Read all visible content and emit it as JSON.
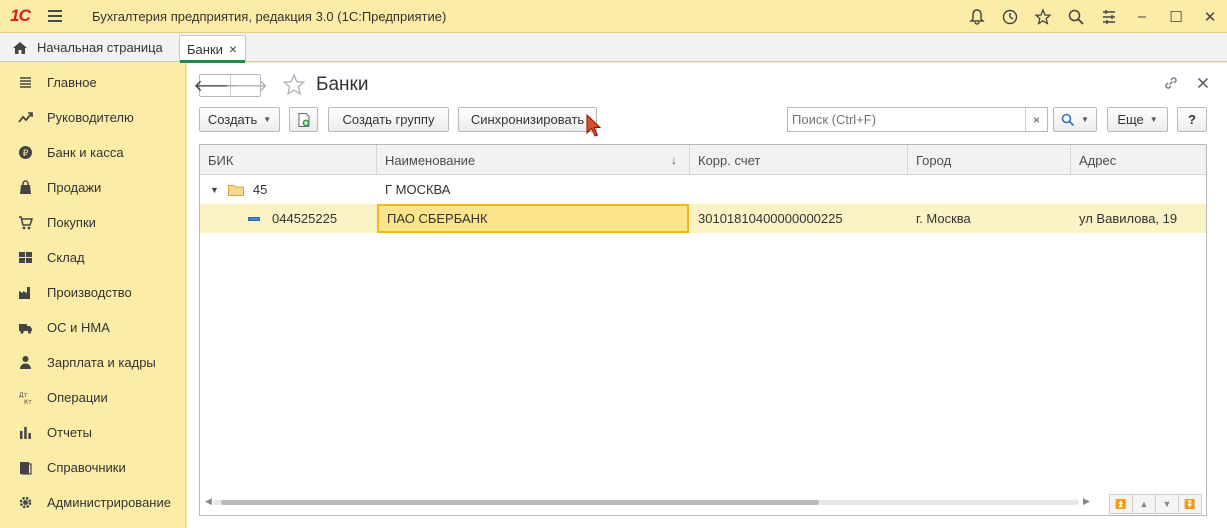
{
  "titlebar": {
    "logo": "1С",
    "app_title": "Бухгалтерия предприятия, редакция 3.0  (1С:Предприятие)",
    "icons": [
      "bell-icon",
      "history-icon",
      "star-icon",
      "search-icon",
      "settings-sliders-icon"
    ],
    "minimize": "‒",
    "maximize": "☐",
    "close": "✕"
  },
  "tabs": {
    "home": "Начальная страница",
    "active": "Банки",
    "active_close": "×"
  },
  "sidebar": {
    "items": [
      {
        "label": "Главное",
        "icon": "menu-lines-icon"
      },
      {
        "label": "Руководителю",
        "icon": "trend-icon"
      },
      {
        "label": "Банк и касса",
        "icon": "coin-icon"
      },
      {
        "label": "Продажи",
        "icon": "bag-icon"
      },
      {
        "label": "Покупки",
        "icon": "cart-icon"
      },
      {
        "label": "Склад",
        "icon": "warehouse-icon"
      },
      {
        "label": "Производство",
        "icon": "factory-icon"
      },
      {
        "label": "ОС и НМА",
        "icon": "truck-icon"
      },
      {
        "label": "Зарплата и кадры",
        "icon": "person-icon"
      },
      {
        "label": "Операции",
        "icon": "dt-kt-icon"
      },
      {
        "label": "Отчеты",
        "icon": "bar-chart-icon"
      },
      {
        "label": "Справочники",
        "icon": "book-icon"
      },
      {
        "label": "Администрирование",
        "icon": "gear-icon"
      }
    ]
  },
  "form": {
    "title": "Банки",
    "back": "🡐",
    "forward": "🡒",
    "buttons": {
      "create": "Создать",
      "create_group": "Создать группу",
      "sync": "Синхронизировать",
      "more": "Еще",
      "help": "?"
    },
    "search": {
      "placeholder": "Поиск (Ctrl+F)",
      "clear": "×"
    }
  },
  "table": {
    "columns": [
      "БИК",
      "Наименование",
      "Корр. счет",
      "Город",
      "Адрес"
    ],
    "sort_indicator": "↓",
    "rows": [
      {
        "bik": "45",
        "name": "Г МОСКВА",
        "account": "",
        "city": "",
        "address": ""
      },
      {
        "bik": "044525225",
        "name": "ПАО СБЕРБАНК",
        "account": "30101810400000000225",
        "city": "г. Москва",
        "address": "ул Вавилова, 19"
      }
    ]
  },
  "colors": {
    "panel": "#fbeca7",
    "accent_green": "#1f8b4c",
    "selection": "#fbf2c6",
    "focus_border": "#f3b61b",
    "logo_red": "#e01b1b"
  }
}
